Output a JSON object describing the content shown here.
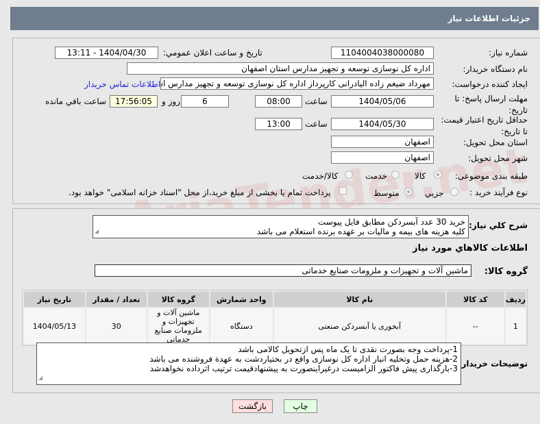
{
  "header": {
    "title": "جزئیات اطلاعات نیاز"
  },
  "fields": {
    "need_number_label": "شماره نیاز:",
    "need_number": "1104004038000080",
    "announce_label": "تاریخ و ساعت اعلان عمومي:",
    "announce_value": "1404/04/30 - 13:11",
    "buyer_org_label": "نام دستگاه خریدار:",
    "buyer_org": "اداره کل نوسازی  توسعه و تجهیز مدارس استان اصفهان",
    "creator_label": "ایجاد کننده درخواست:",
    "creator": "مهرداد ضیغم زاده الیادرانی کارپرداز اداره کل نوسازی  توسعه و تجهیز مدارس اس",
    "contact_link": "اطلاعات تماس خریدار",
    "deadline_label": "مهلت ارسال پاسخ: تا تاریخ:",
    "deadline_date": "1404/05/06",
    "time_label": "ساعت",
    "deadline_time": "08:00",
    "days": "6",
    "days_label": "روز و",
    "remaining": "17:56:05",
    "remaining_label": "ساعت باقي مانده",
    "validity_label": "حداقل تاریخ اعتبار قیمت: تا تاریخ:",
    "validity_date": "1404/05/30",
    "validity_time": "13:00",
    "province_label": "استان محل تحویل:",
    "province": "اصفهان",
    "city_label": "شهر محل تحویل:",
    "city": "اصفهان",
    "category_label": "طبقه بندی موضوعی:",
    "category_options": [
      "کالا",
      "خدمت",
      "کالا/خدمت"
    ],
    "process_label": "نوع فرآیند خرید :",
    "process_options": [
      "جزیي",
      "متوسط"
    ],
    "treasury_note": "پرداخت تمام یا بخشی از مبلغ خرید،از محل \"اسناد خزانه اسلامی\" خواهد بود."
  },
  "details": {
    "desc_label": "شرح كلي نياز:",
    "desc_lines": [
      "خرید 30 عدد آبسردکن مطابق فایل پیوست",
      "کلیه هزینه های بیمه و مالیات بر عهده برنده استعلام می باشد"
    ],
    "goods_title": "اطلاعات کالاهاي مورد نياز",
    "group_label": "گروه کالا:",
    "group_value": "ماشین آلات و تجهیزات و ملزومات صنایع خدماتی",
    "table": {
      "headers": [
        "رديف",
        "کد کالا",
        "نام کالا",
        "واحد شمارش",
        "گروه کالا",
        "تعداد / مقدار",
        "تاریخ نیاز"
      ],
      "rows": [
        [
          "1",
          "--",
          "آبخوری یا آبسردکن صنعتی",
          "دستگاه",
          "ماشین آلات و تجهیزات و ملزومات صنایع خدماتی",
          "30",
          "1404/05/13"
        ]
      ]
    },
    "notes_label": "توضیحات خریدار:",
    "notes_lines": [
      "1-پرداخت وجه بصورت نقدی تا یک ماه پس ازتحویل کالامی باشد",
      "2-هزینه حمل وتخلیه انبار اداره کل نوسازی واقع در بختیاردشت به عهدة فروشنده می باشد",
      "3-بارگذاری پیش فاکتور الزامیست درغیراینصورت به پیشنهادقیمت ترتیب اثرداده نخواهدشد"
    ]
  },
  "buttons": {
    "back": "بازگشت",
    "print": "چاپ"
  },
  "watermark": "AriaTender.net"
}
